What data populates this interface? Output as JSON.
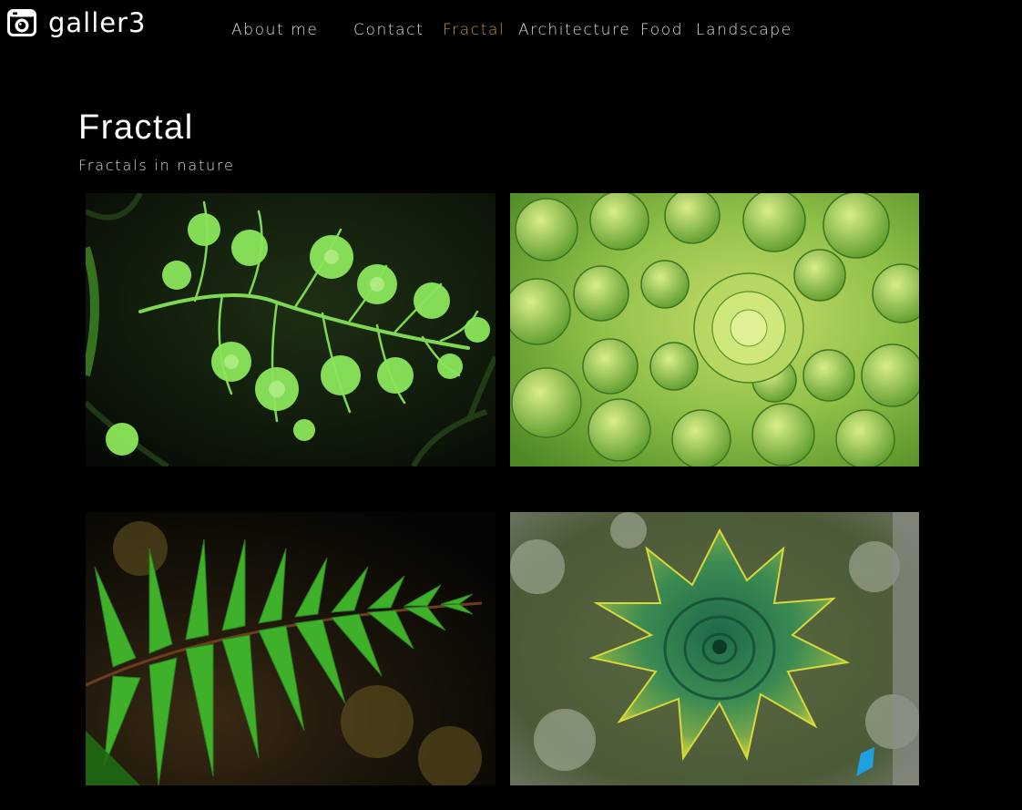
{
  "brand": {
    "name": "galler3",
    "logo_icon": "camera-icon"
  },
  "nav": {
    "items": [
      {
        "label": "About me",
        "active": false
      },
      {
        "label": "Contact",
        "active": false
      },
      {
        "label": "Fractal",
        "active": true
      },
      {
        "label": "Architecture",
        "active": false
      },
      {
        "label": "Food",
        "active": false
      },
      {
        "label": "Landscape",
        "active": false
      }
    ],
    "active_color": "#c4915a"
  },
  "page": {
    "title": "Fractal",
    "subtitle": "Fractals in nature"
  },
  "gallery": {
    "images": [
      {
        "subject": "fractal-fern-leaf-photo"
      },
      {
        "subject": "romanesco-broccoli-photo"
      },
      {
        "subject": "fern-frond-photo"
      },
      {
        "subject": "spiral-aloe-photo"
      }
    ]
  }
}
